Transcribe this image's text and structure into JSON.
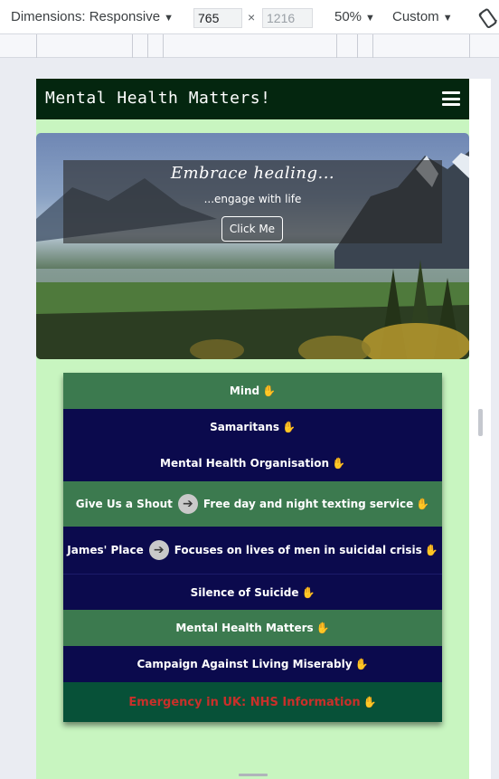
{
  "devtools": {
    "dimensions_label": "Dimensions: Responsive",
    "width_value": "765",
    "height_placeholder": "1216",
    "times": "×",
    "zoom": "50%",
    "throttle": "Custom",
    "dropdown_arrow": "▼"
  },
  "site": {
    "brand": "Mental Health Matters!",
    "hero": {
      "title": "Embrace healing...",
      "subtitle": "...engage with life",
      "button": "Click Me"
    },
    "links": [
      {
        "label": "Mind",
        "color": "green"
      },
      {
        "label": "Samaritans",
        "color": "navy"
      },
      {
        "label": "Mental Health Organisation",
        "color": "navy"
      },
      {
        "label": "Give Us a Shout",
        "detail": "Free day and night texting service",
        "color": "green"
      },
      {
        "label": "James' Place",
        "detail": "Focuses on lives of men in suicidal crisis",
        "color": "navy"
      },
      {
        "label": "Silence of Suicide",
        "color": "navy"
      },
      {
        "label": "Mental Health Matters",
        "color": "green"
      },
      {
        "label": "Campaign Against Living Miserably",
        "color": "navy"
      },
      {
        "label": "Emergency in UK: NHS Information",
        "color": "emergency"
      }
    ],
    "hand_icon": "✋",
    "arrow_icon": "➔"
  },
  "colors": {
    "page_bg": "#c8f5c0",
    "navbar": "#04260f",
    "green_row": "#3c7a4f",
    "navy_row": "#0b0a4d",
    "emergency_row": "#075138",
    "emergency_text": "#c8302a"
  }
}
